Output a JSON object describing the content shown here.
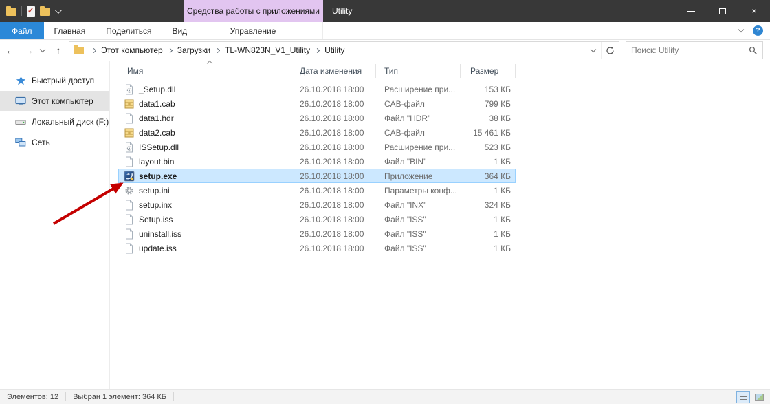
{
  "window": {
    "title": "Utility"
  },
  "titlebar": {
    "contextual_group_label": "Средства работы с приложениями",
    "quick_access": [
      {
        "icon": "folder-icon"
      },
      {
        "icon": "properties-icon"
      },
      {
        "icon": "folder-icon"
      },
      {
        "icon": "chevron-down-icon"
      }
    ],
    "controls": [
      {
        "id": "minimize"
      },
      {
        "id": "maximize"
      },
      {
        "id": "close"
      }
    ]
  },
  "ribbon": {
    "tabs": [
      {
        "id": "file",
        "label": "Файл",
        "accent": true
      },
      {
        "id": "home",
        "label": "Главная"
      },
      {
        "id": "share",
        "label": "Поделиться"
      },
      {
        "id": "view",
        "label": "Вид"
      },
      {
        "id": "manage",
        "label": "Управление",
        "contextual": true
      }
    ]
  },
  "addressbar": {
    "breadcrumb": [
      "Этот компьютер",
      "Загрузки",
      "TL-WN823N_V1_Utility",
      "Utility"
    ],
    "search_placeholder": "Поиск: Utility"
  },
  "sidebar": {
    "items": [
      {
        "id": "quick-access",
        "label": "Быстрый доступ",
        "icon": "star-icon"
      },
      {
        "id": "this-pc",
        "label": "Этот компьютер",
        "icon": "computer-icon",
        "selected": true
      },
      {
        "id": "local-disk-f",
        "label": "Локальный диск (F:)",
        "icon": "disk-icon"
      },
      {
        "id": "network",
        "label": "Сеть",
        "icon": "network-icon"
      }
    ]
  },
  "file_list": {
    "columns": [
      {
        "id": "name",
        "label": "Имя"
      },
      {
        "id": "date",
        "label": "Дата изменения"
      },
      {
        "id": "type",
        "label": "Тип"
      },
      {
        "id": "size",
        "label": "Размер"
      }
    ],
    "rows": [
      {
        "name": "_Setup.dll",
        "date": "26.10.2018 18:00",
        "type": "Расширение при...",
        "size": "153 КБ",
        "icon": "dll"
      },
      {
        "name": "data1.cab",
        "date": "26.10.2018 18:00",
        "type": "CAB-файл",
        "size": "799 КБ",
        "icon": "cab"
      },
      {
        "name": "data1.hdr",
        "date": "26.10.2018 18:00",
        "type": "Файл \"HDR\"",
        "size": "38 КБ",
        "icon": "page"
      },
      {
        "name": "data2.cab",
        "date": "26.10.2018 18:00",
        "type": "CAB-файл",
        "size": "15 461 КБ",
        "icon": "cab"
      },
      {
        "name": "ISSetup.dll",
        "date": "26.10.2018 18:00",
        "type": "Расширение при...",
        "size": "523 КБ",
        "icon": "dll"
      },
      {
        "name": "layout.bin",
        "date": "26.10.2018 18:00",
        "type": "Файл \"BIN\"",
        "size": "1 КБ",
        "icon": "page"
      },
      {
        "name": "setup.exe",
        "date": "26.10.2018 18:00",
        "type": "Приложение",
        "size": "364 КБ",
        "icon": "exe",
        "selected": true
      },
      {
        "name": "setup.ini",
        "date": "26.10.2018 18:00",
        "type": "Параметры конф...",
        "size": "1 КБ",
        "icon": "gear"
      },
      {
        "name": "setup.inx",
        "date": "26.10.2018 18:00",
        "type": "Файл \"INX\"",
        "size": "324 КБ",
        "icon": "page"
      },
      {
        "name": "Setup.iss",
        "date": "26.10.2018 18:00",
        "type": "Файл \"ISS\"",
        "size": "1 КБ",
        "icon": "page"
      },
      {
        "name": "uninstall.iss",
        "date": "26.10.2018 18:00",
        "type": "Файл \"ISS\"",
        "size": "1 КБ",
        "icon": "page"
      },
      {
        "name": "update.iss",
        "date": "26.10.2018 18:00",
        "type": "Файл \"ISS\"",
        "size": "1 КБ",
        "icon": "page"
      }
    ]
  },
  "statusbar": {
    "items_count": "Элементов: 12",
    "selection_info": "Выбран 1 элемент: 364 КБ"
  },
  "annotation": {
    "arrow_target": "setup.exe",
    "arrow_color": "#c40000"
  },
  "colors": {
    "titlebar_bg": "#383838",
    "accent_tab": "#2b88d8",
    "contextual_highlight": "#e2c5f0",
    "selected_row_bg": "#cce8ff",
    "selected_row_border": "#99d1ff",
    "sidebar_selected_bg": "#e4e4e4"
  }
}
